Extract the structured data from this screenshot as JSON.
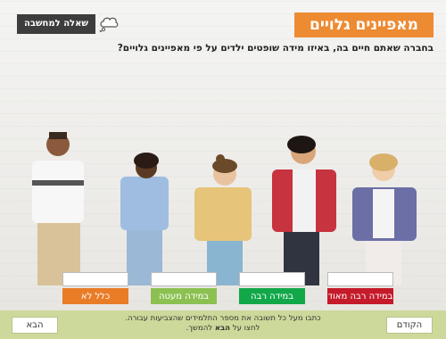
{
  "title": "מאפיינים גלויים",
  "think_label": "שאלה למחשבה",
  "question": "בחברה שאתם חיים בה, באיזו מידה שופטים ילדים על פי מאפיינים גלויים?",
  "answers": [
    {
      "label": "כלל לא",
      "color": "#e97c26"
    },
    {
      "label": "במידה מעטה",
      "color": "#8cc152"
    },
    {
      "label": "במידה רבה",
      "color": "#12a84a"
    },
    {
      "label": "במידה רבה מאוד",
      "color": "#c51a2a"
    }
  ],
  "footer": {
    "prev_label": "הקודם",
    "next_label": "הבא",
    "instruction_line1": "כתבו מעל כל תשובה את מספר התלמידים שהצביעות עבורה.",
    "instruction_line2_pre": "לחצו על ",
    "instruction_line2_bold": "הבא",
    "instruction_line2_post": " להמשך."
  }
}
